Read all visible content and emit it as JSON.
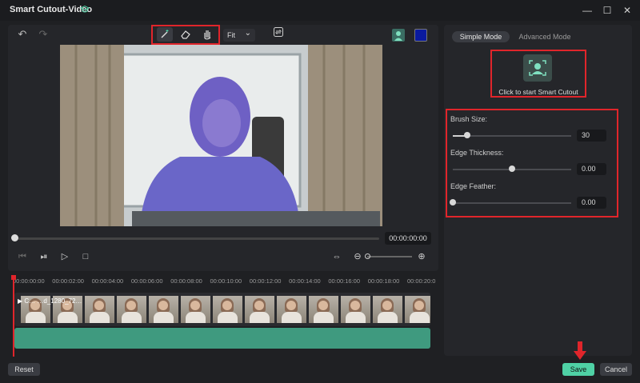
{
  "window": {
    "title": "Smart Cutout-Video",
    "minimize": "—",
    "maximize": "☐",
    "close": "✕"
  },
  "toolbar": {
    "undo": "↶",
    "redo": "↷",
    "fit_label": "Fit",
    "fit_arrow": "⌄"
  },
  "tools": [
    "brush-add-icon",
    "eraser-icon",
    "hand-icon"
  ],
  "preview": {
    "timecode": "00:00:00:00"
  },
  "timeline": {
    "ruler": [
      "00:00:00:00",
      "00:00:02:00",
      "00:00:04:00",
      "00:00:06:00",
      "00:00:08:00",
      "00:00:10:00",
      "00:00:12:00",
      "00:00:14:00",
      "00:00:16:00",
      "00:00:18:00",
      "00:00:20:0"
    ],
    "clip_name": "C… …d_1280_72…",
    "mask_color": "#3f9a7f"
  },
  "panel": {
    "tabs": {
      "simple": "Simple Mode",
      "advanced": "Advanced Mode",
      "active": "simple"
    },
    "cutout_label": "Click to start Smart Cutout",
    "brush_size": {
      "label": "Brush Size:",
      "value": "30",
      "fraction": 0.12
    },
    "edge_thickness": {
      "label": "Edge Thickness:",
      "value": "0.00",
      "fraction": 0.5
    },
    "edge_feather": {
      "label": "Edge Feather:",
      "value": "0.00",
      "fraction": 0.0
    }
  },
  "footer": {
    "reset": "Reset",
    "save": "Save",
    "cancel": "Cancel"
  },
  "colors": {
    "accent": "#4fd1a5",
    "highlight": "#e0252b",
    "swatch": "#0a1aa0"
  }
}
